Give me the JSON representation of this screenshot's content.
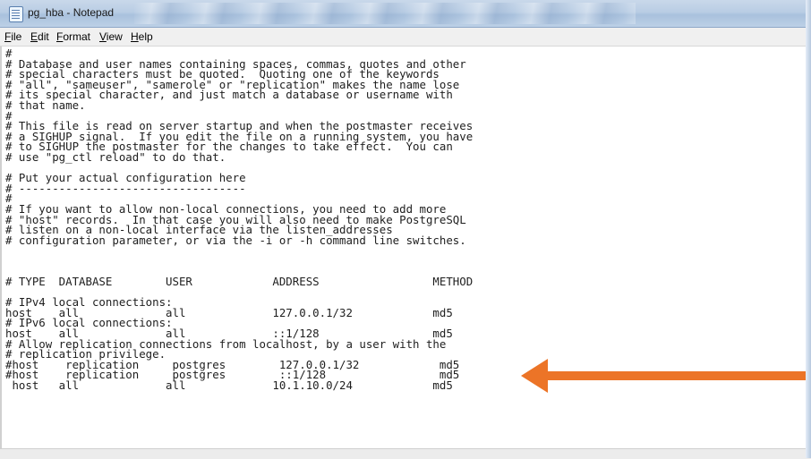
{
  "window": {
    "title": "pg_hba - Notepad",
    "icon": "notepad-icon"
  },
  "menu": [
    "File",
    "Edit",
    "Format",
    "View",
    "Help"
  ],
  "editor": {
    "lines": [
      "#",
      "# Database and user names containing spaces, commas, quotes and other",
      "# special characters must be quoted.  Quoting one of the keywords",
      "# \"all\", \"sameuser\", \"samerole\" or \"replication\" makes the name lose",
      "# its special character, and just match a database or username with",
      "# that name.",
      "#",
      "# This file is read on server startup and when the postmaster receives",
      "# a SIGHUP signal.  If you edit the file on a running system, you have",
      "# to SIGHUP the postmaster for the changes to take effect.  You can",
      "# use \"pg_ctl reload\" to do that.",
      "",
      "# Put your actual configuration here",
      "# ----------------------------------",
      "#",
      "# If you want to allow non-local connections, you need to add more",
      "# \"host\" records.  In that case you will also need to make PostgreSQL",
      "# listen on a non-local interface via the listen_addresses",
      "# configuration parameter, or via the -i or -h command line switches.",
      "",
      "",
      "",
      "# TYPE  DATABASE        USER            ADDRESS                 METHOD",
      "",
      "# IPv4 local connections:",
      "host    all             all             127.0.0.1/32            md5",
      "# IPv6 local connections:",
      "host    all             all             ::1/128                 md5",
      "# Allow replication connections from localhost, by a user with the",
      "# replication privilege.",
      "#host    replication     postgres        127.0.0.1/32            md5",
      "#host    replication     postgres        ::1/128                 md5",
      " host   all             all             10.1.10.0/24            md5"
    ]
  },
  "colors": {
    "arrow": "#ec7427"
  }
}
